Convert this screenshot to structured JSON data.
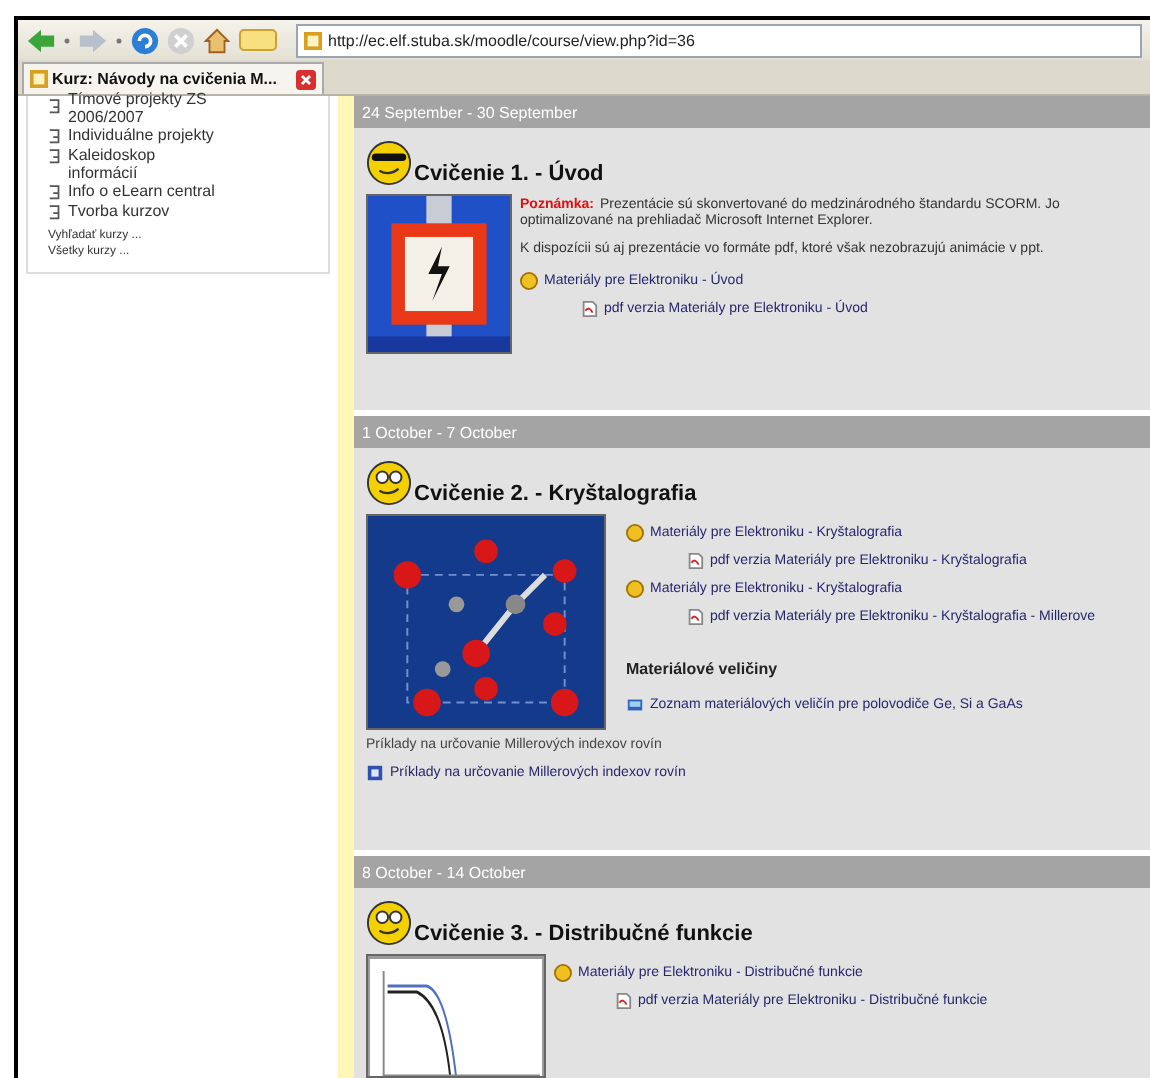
{
  "toolbar": {
    "address": "http://ec.elf.stuba.sk/moodle/course/view.php?id=36"
  },
  "tabs": [
    {
      "label": "Kurz: Návody na cvičenia M...",
      "selected": true
    }
  ],
  "sidebar": {
    "items": [
      {
        "label": "Tímové projekty ZS 2006/2007"
      },
      {
        "label": "Individuálne projekty"
      },
      {
        "label": "Kaleidoskop informácií"
      },
      {
        "label": "Info o eLearn central"
      },
      {
        "label": "Tvorba kurzov"
      }
    ],
    "links": [
      "Vyhľadať kurzy ...",
      "Všetky kurzy ..."
    ]
  },
  "sections": [
    {
      "dates": "24 September - 30 September",
      "title": "Cvičenie 1. - Úvod",
      "note_label": "Poznámka:",
      "note_lines": [
        "Prezentácie sú skonvertované do medzinárodného štandardu SCORM. Jo",
        "optimalizované na prehliadač Microsoft Internet Explorer."
      ],
      "paragraph": "K dispozícii sú aj prezentácie vo formáte pdf, ktoré však nezobrazujú animácie v ppt.",
      "resources": [
        {
          "kind": "scorm",
          "label": "Materiály pre Elektroniku - Úvod"
        },
        {
          "kind": "pdf",
          "label": "pdf verzia Materiály pre Elektroniku - Úvod"
        }
      ]
    },
    {
      "dates": "1 October - 7 October",
      "title": "Cvičenie 2. - Kryštalografia",
      "resources": [
        {
          "kind": "scorm",
          "label": "Materiály pre Elektroniku - Kryštalografia"
        },
        {
          "kind": "pdf",
          "label": "pdf verzia Materiály pre Elektroniku - Kryštalografia"
        },
        {
          "kind": "scorm",
          "label": "Materiály pre Elektroniku - Kryštalografia"
        },
        {
          "kind": "pdf",
          "label": "pdf verzia Materiály pre Elektroniku - Kryštalografia - Millerove"
        },
        {
          "kind": "heading",
          "label": "Materiálové veličiny"
        },
        {
          "kind": "file",
          "label": "Zoznam materiálových veličín pre polovodiče Ge, Si a GaAs"
        }
      ],
      "after": [
        {
          "kind": "text",
          "label": "Príklady na určovanie Millerových indexov rovín"
        },
        {
          "kind": "page",
          "label": "Príklady na určovanie Millerových indexov rovín"
        }
      ]
    },
    {
      "dates": "8 October - 14 October",
      "title": "Cvičenie 3. - Distribučné funkcie",
      "resources": [
        {
          "kind": "scorm",
          "label": "Materiály pre Elektroniku - Distribučné funkcie"
        },
        {
          "kind": "pdf",
          "label": "pdf verzia Materiály pre Elektroniku - Distribučné funkcie"
        }
      ]
    }
  ]
}
